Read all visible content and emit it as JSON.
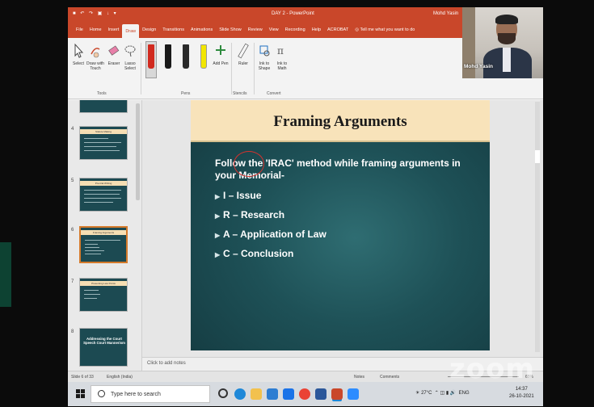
{
  "window": {
    "quick_access": "■ ↶ ↷ ▣ ↓ ▾",
    "title": "DAY 2  -  PowerPoint",
    "user": "Mohd Yasin"
  },
  "ribbon_tabs": [
    "File",
    "Home",
    "Insert",
    "Draw",
    "Design",
    "Transitions",
    "Animations",
    "Slide Show",
    "Review",
    "View",
    "Recording",
    "Help",
    "ACROBAT"
  ],
  "active_tab": "Draw",
  "tell_me": "Tell me what you want to do",
  "ribbon": {
    "tools": {
      "select": "Select",
      "draw_touch": "Draw with Touch",
      "eraser": "Eraser",
      "lasso": "Lasso Select",
      "label": "Tools"
    },
    "pens": {
      "add_pen": "Add Pen",
      "label": "Pens",
      "colors": [
        "#d12a1f",
        "#1a1a1a",
        "#2a2a2a",
        "#f2e600"
      ]
    },
    "stencils": {
      "ruler": "Ruler",
      "label": "Stencils"
    },
    "convert": {
      "ink_shape": "Ink to Shape",
      "ink_math": "Ink to Math",
      "label": "Convert"
    }
  },
  "webcam": {
    "name": "Mohd Yasin"
  },
  "thumbnails": [
    {
      "num": "4",
      "title": "Statute Making"
    },
    {
      "num": "5",
      "title": "Pre-trial Writing"
    },
    {
      "num": "6",
      "title": "Framing Arguments"
    },
    {
      "num": "7",
      "title": "Presenting Law Points"
    },
    {
      "num": "8",
      "title": "Addressing the Court Speech Court Mannerism"
    }
  ],
  "slide": {
    "title": "Framing Arguments",
    "intro_before": "Follow the ",
    "intro_highlight": "'IRAC'",
    "intro_after": " method while framing arguments in your Memorial-",
    "bullets": [
      "I – Issue",
      "R – Research",
      "A – Application of Law",
      "C – Conclusion"
    ]
  },
  "notes_placeholder": "Click to add notes",
  "status": {
    "slide_of": "Slide 6 of 33",
    "language": "English (India)",
    "notes": "Notes",
    "comments": "Comments",
    "zoom": "65%"
  },
  "zoom_watermark": "zoom",
  "taskbar": {
    "search_placeholder": "Type here to search",
    "weather": "27°C",
    "lang": "ENG",
    "time": "14:37",
    "date": "26-10-2021"
  }
}
